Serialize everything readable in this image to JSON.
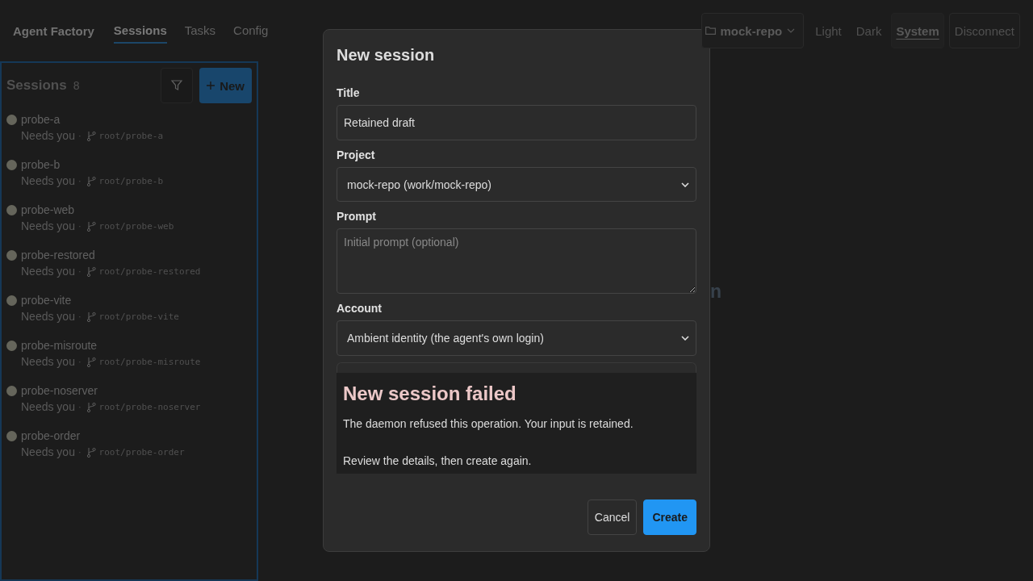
{
  "app": {
    "title": "Agent Factory"
  },
  "nav": [
    {
      "label": "Sessions",
      "selected": true
    },
    {
      "label": "Tasks",
      "selected": false
    },
    {
      "label": "Config",
      "selected": false
    }
  ],
  "repo_picker": {
    "label": "mock-repo"
  },
  "themes": [
    {
      "label": "Light",
      "selected": false
    },
    {
      "label": "Dark",
      "selected": false
    },
    {
      "label": "System",
      "selected": true
    }
  ],
  "disconnect": {
    "label": "Disconnect"
  },
  "sidebar": {
    "title": "Sessions",
    "count": "8",
    "new_button": "New",
    "items": [
      {
        "name": "probe-a",
        "status": "Needs you",
        "separator": "·",
        "branch": "root/probe-a"
      },
      {
        "name": "probe-b",
        "status": "Needs you",
        "separator": "·",
        "branch": "root/probe-b"
      },
      {
        "name": "probe-web",
        "status": "Needs you",
        "separator": "·",
        "branch": "root/probe-web"
      },
      {
        "name": "probe-restored",
        "status": "Needs you",
        "separator": "·",
        "branch": "root/probe-restored"
      },
      {
        "name": "probe-vite",
        "status": "Needs you",
        "separator": "·",
        "branch": "root/probe-vite"
      },
      {
        "name": "probe-misroute",
        "status": "Needs you",
        "separator": "·",
        "branch": "root/probe-misroute"
      },
      {
        "name": "probe-noserver",
        "status": "Needs you",
        "separator": "·",
        "branch": "root/probe-noserver"
      },
      {
        "name": "probe-order",
        "status": "Needs you",
        "separator": "·",
        "branch": "root/probe-order"
      }
    ]
  },
  "main": {
    "hidden_text": "n"
  },
  "dialog": {
    "title": "New session",
    "fields": [
      {
        "kind": "input",
        "label": "Title",
        "value": "Retained draft"
      },
      {
        "kind": "select",
        "label": "Project",
        "value": "mock-repo (work/mock-repo)"
      },
      {
        "kind": "textarea",
        "label": "Prompt",
        "placeholder": "Initial prompt (optional)"
      },
      {
        "kind": "select",
        "label": "Account",
        "value": "Ambient identity (the agent's own login)"
      }
    ],
    "error": {
      "title": "New session failed",
      "lines": [
        "The daemon refused this operation. Your input is retained.",
        "Review the details, then create again."
      ]
    },
    "buttons": [
      {
        "label": "Cancel",
        "kind": "secondary"
      },
      {
        "label": "Create",
        "kind": "primary"
      }
    ]
  }
}
